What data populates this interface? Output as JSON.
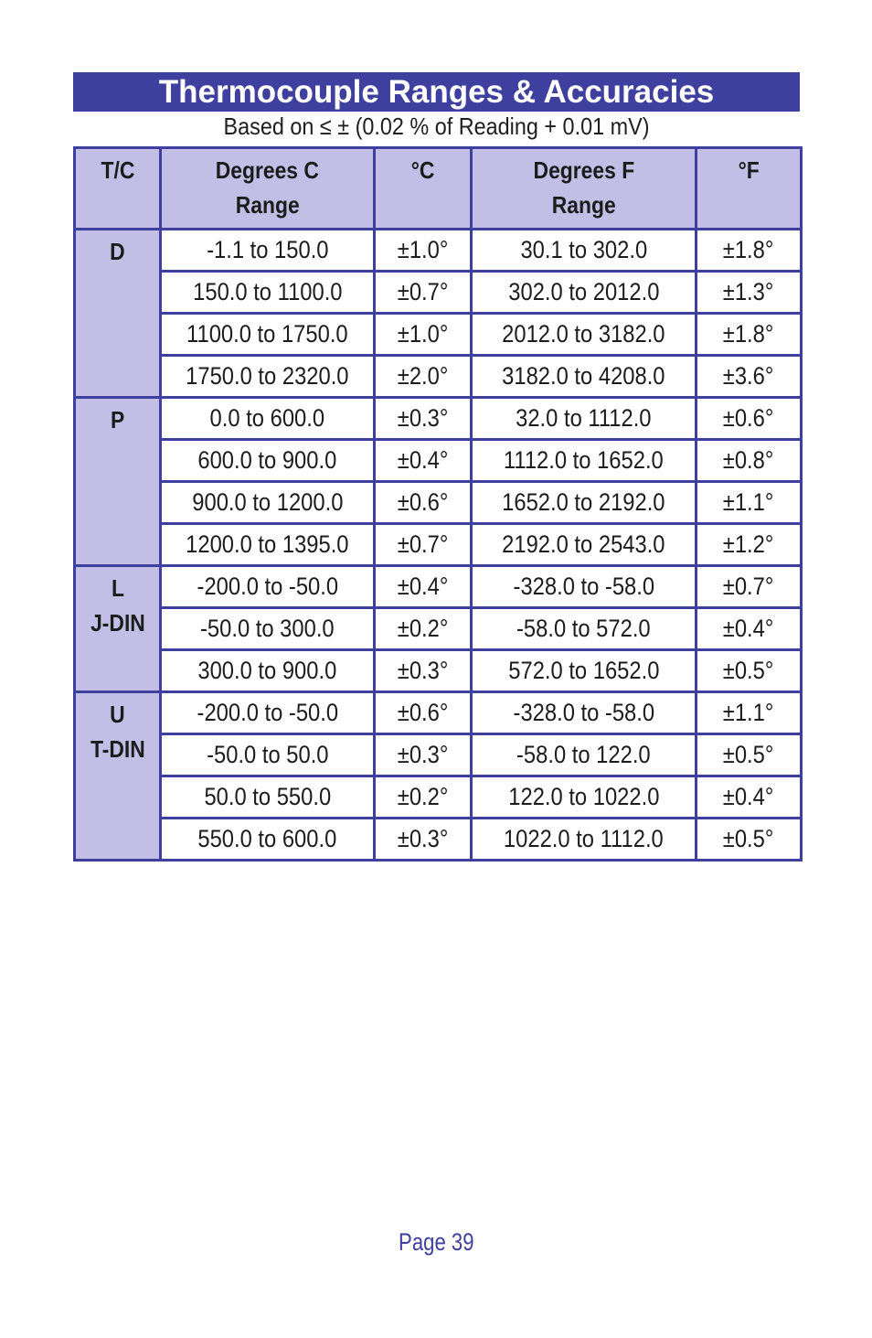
{
  "title": "Thermocouple Ranges & Accuracies",
  "subtitle": "Based on ≤ ± (0.02 % of Reading + 0.01 mV)",
  "headers": {
    "tc": "T/C",
    "c_range_line1": "Degrees C",
    "c_range_line2": "Range",
    "c_acc": "°C",
    "f_range_line1": "Degrees F",
    "f_range_line2": "Range",
    "f_acc": "°F"
  },
  "groups": [
    {
      "type_line1": "D",
      "type_line2": "",
      "rows": [
        {
          "c_range": "-1.1 to 150.0",
          "c_acc": "±1.0°",
          "f_range": "30.1 to 302.0",
          "f_acc": "±1.8°"
        },
        {
          "c_range": "150.0 to 1100.0",
          "c_acc": "±0.7°",
          "f_range": "302.0 to 2012.0",
          "f_acc": "±1.3°"
        },
        {
          "c_range": "1100.0 to 1750.0",
          "c_acc": "±1.0°",
          "f_range": "2012.0 to 3182.0",
          "f_acc": "±1.8°"
        },
        {
          "c_range": "1750.0 to 2320.0",
          "c_acc": "±2.0°",
          "f_range": "3182.0 to 4208.0",
          "f_acc": "±3.6°"
        }
      ]
    },
    {
      "type_line1": "P",
      "type_line2": "",
      "rows": [
        {
          "c_range": "0.0 to 600.0",
          "c_acc": "±0.3°",
          "f_range": "32.0 to 1112.0",
          "f_acc": "±0.6°"
        },
        {
          "c_range": "600.0 to 900.0",
          "c_acc": "±0.4°",
          "f_range": "1112.0 to 1652.0",
          "f_acc": "±0.8°"
        },
        {
          "c_range": "900.0 to 1200.0",
          "c_acc": "±0.6°",
          "f_range": "1652.0 to 2192.0",
          "f_acc": "±1.1°"
        },
        {
          "c_range": "1200.0 to 1395.0",
          "c_acc": "±0.7°",
          "f_range": "2192.0 to 2543.0",
          "f_acc": "±1.2°"
        }
      ]
    },
    {
      "type_line1": "L",
      "type_line2": "J-DIN",
      "rows": [
        {
          "c_range": "-200.0 to -50.0",
          "c_acc": "±0.4°",
          "f_range": "-328.0 to -58.0",
          "f_acc": "±0.7°"
        },
        {
          "c_range": "-50.0 to 300.0",
          "c_acc": "±0.2°",
          "f_range": "-58.0 to 572.0",
          "f_acc": "±0.4°"
        },
        {
          "c_range": "300.0 to 900.0",
          "c_acc": "±0.3°",
          "f_range": "572.0 to 1652.0",
          "f_acc": "±0.5°"
        }
      ]
    },
    {
      "type_line1": "U",
      "type_line2": "T-DIN",
      "rows": [
        {
          "c_range": "-200.0 to -50.0",
          "c_acc": "±0.6°",
          "f_range": "-328.0 to -58.0",
          "f_acc": "±1.1°"
        },
        {
          "c_range": "-50.0 to 50.0",
          "c_acc": "±0.3°",
          "f_range": "-58.0 to 122.0",
          "f_acc": "±0.5°"
        },
        {
          "c_range": "50.0 to 550.0",
          "c_acc": "±0.2°",
          "f_range": "122.0 to 1022.0",
          "f_acc": "±0.4°"
        },
        {
          "c_range": "550.0 to 600.0",
          "c_acc": "±0.3°",
          "f_range": "1022.0 to 1112.0",
          "f_acc": "±0.5°"
        }
      ]
    }
  ],
  "page_label": "Page 39",
  "colors": {
    "accent": "#3f3f9f",
    "header_fill": "#c3bee6"
  }
}
